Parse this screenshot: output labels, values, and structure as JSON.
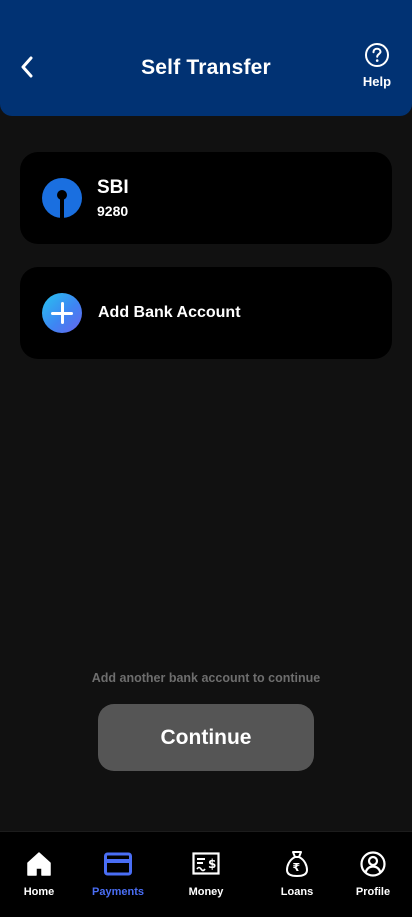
{
  "header": {
    "title": "Self Transfer",
    "help_label": "Help"
  },
  "accounts": [
    {
      "bank": "SBI",
      "number": "9280",
      "icon": "sbi-logo-icon"
    }
  ],
  "add_account": {
    "label": "Add Bank Account",
    "icon": "plus-icon"
  },
  "hint": "Add another bank account to continue",
  "continue_label": "Continue",
  "nav": {
    "active": "Payments",
    "items": [
      {
        "label": "Home",
        "icon": "home-icon"
      },
      {
        "label": "Payments",
        "icon": "card-icon"
      },
      {
        "label": "Money",
        "icon": "cheque-icon"
      },
      {
        "label": "Loans",
        "icon": "rupee-bag-icon"
      },
      {
        "label": "Profile",
        "icon": "user-icon"
      }
    ]
  },
  "colors": {
    "header_bg": "#013273",
    "page_bg": "#111111",
    "card_bg": "#000000",
    "active_nav": "#4a6ef5",
    "button_bg": "#555555",
    "bank_logo": "#1a6fe0"
  }
}
